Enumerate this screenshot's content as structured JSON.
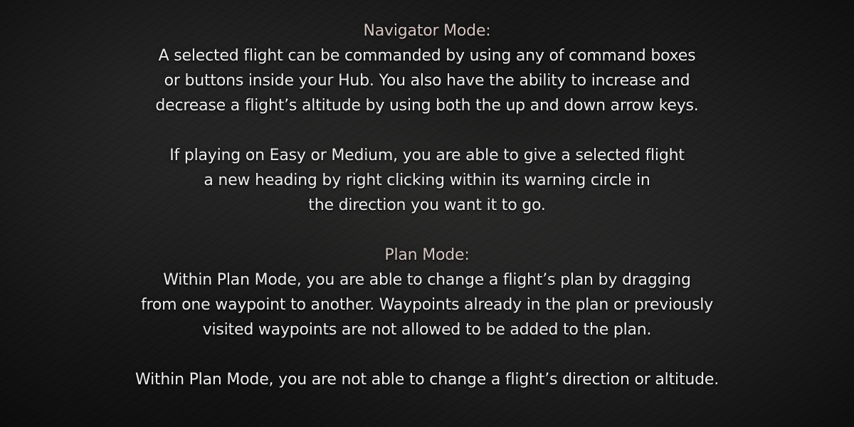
{
  "navigator": {
    "heading": "Navigator Mode:",
    "para1": [
      "A selected flight can be commanded by using any of command boxes",
      "or buttons inside your Hub. You also have the ability to increase and",
      "decrease a flight’s altitude by using both the up and down arrow keys."
    ],
    "para2": [
      "If playing on Easy or Medium, you are able to give a selected flight",
      "a new heading by right clicking within its warning circle in",
      "the direction you want it to go."
    ]
  },
  "plan": {
    "heading": "Plan Mode:",
    "para1": [
      "Within Plan Mode, you are able to change a flight’s plan by dragging",
      "from one waypoint to another. Waypoints already in the plan or previously",
      "visited waypoints are not allowed to be added to the plan."
    ],
    "para2": [
      "Within Plan Mode, you are not able to change a flight’s direction or altitude."
    ]
  },
  "colors": {
    "heading": "#d7c7c4",
    "body_text": "#eeeeee",
    "background": "#1b1b1b"
  }
}
